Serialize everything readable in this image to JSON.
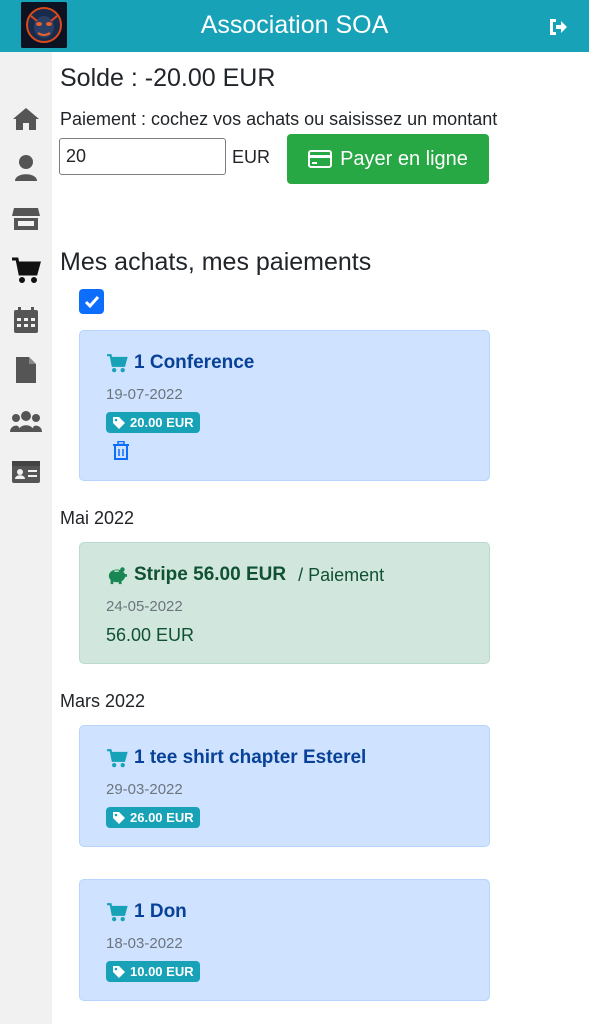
{
  "header": {
    "title": "Association SOA",
    "logo_icon": "gorilla-logo",
    "logout_icon": "sign-out-icon",
    "color": "#17a2b8"
  },
  "sidebar": {
    "items": [
      {
        "icon": "home-icon"
      },
      {
        "icon": "user-icon"
      },
      {
        "icon": "store-icon"
      },
      {
        "icon": "cart-icon",
        "active": true
      },
      {
        "icon": "calendar-icon"
      },
      {
        "icon": "file-icon"
      },
      {
        "icon": "users-icon"
      },
      {
        "icon": "id-card-icon"
      }
    ]
  },
  "balance": "Solde : -20.00 EUR",
  "payment": {
    "instruction": "Paiement : cochez vos achats ou saisissez un montant",
    "amount_value": "20",
    "currency": "EUR",
    "button_label": "Payer en ligne"
  },
  "history": {
    "title": "Mes achats, mes paiements",
    "select_all_checked": true,
    "months": [
      "Mai 2022",
      "Mars 2022"
    ],
    "entries": [
      {
        "type": "purchase",
        "title": "1 Conference",
        "date": "19-07-2022",
        "price": "20.00 EUR",
        "deletable": true
      },
      {
        "type": "payment",
        "title": "Stripe 56.00 EUR",
        "subtitle": "/ Paiement",
        "date": "24-05-2022",
        "amount": "56.00 EUR"
      },
      {
        "type": "purchase",
        "title": "1 tee shirt chapter Esterel",
        "date": "29-03-2022",
        "price": "26.00 EUR"
      },
      {
        "type": "purchase",
        "title": "1 Don",
        "date": "18-03-2022",
        "price": "10.00 EUR"
      }
    ]
  },
  "colors": {
    "accent": "#17a2b8",
    "success": "#28a745",
    "purchase_card": "#cfe2ff",
    "payment_card": "#d1e7dd"
  }
}
